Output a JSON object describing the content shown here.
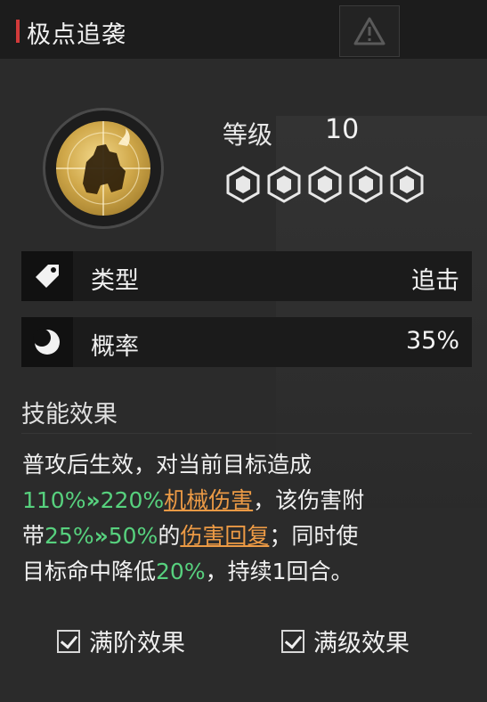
{
  "header": {
    "title": "极点追袭"
  },
  "skill": {
    "level_label": "等级",
    "level_value": "10",
    "level_pips": 5
  },
  "rows": [
    {
      "icon": "tag-icon",
      "label": "类型",
      "value": "追击"
    },
    {
      "icon": "moon-icon",
      "label": "概率",
      "value": "35%"
    }
  ],
  "effect": {
    "section_title": "技能效果",
    "line1": "普攻后生效，对当前目标造成",
    "dmg_from": "110%",
    "dmg_to": "220%",
    "dmg_type": "机械伤害",
    "line2_tail": "，该伤害附",
    "line3_head": "带",
    "heal_from": "25%",
    "heal_to": "50%",
    "line3_mid": "的",
    "heal_type": "伤害回复",
    "line3_tail": "；同时使",
    "line4_head": "目标命中降低",
    "hit_down": "20%",
    "line4_tail": "，持续1回合。"
  },
  "toggles": {
    "max_tier": "满阶效果",
    "max_level": "满级效果"
  },
  "colors": {
    "accent_red": "#d23a3a",
    "highlight_green": "#57d17e",
    "highlight_orange": "#ec9a45",
    "emblem_gold": "#d0a84a"
  }
}
